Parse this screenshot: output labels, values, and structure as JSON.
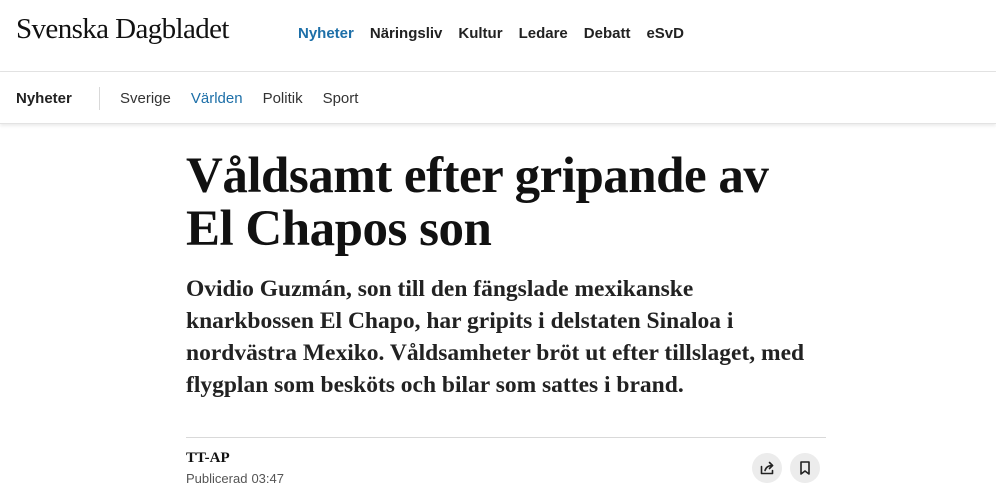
{
  "site": {
    "logo": "Svenska Dagbladet"
  },
  "main_nav": {
    "items": [
      {
        "label": "Nyheter",
        "active": true
      },
      {
        "label": "Näringsliv"
      },
      {
        "label": "Kultur"
      },
      {
        "label": "Ledare"
      },
      {
        "label": "Debatt"
      },
      {
        "label": "eSvD"
      }
    ]
  },
  "sub_nav": {
    "section": "Nyheter",
    "items": [
      {
        "label": "Sverige"
      },
      {
        "label": "Världen",
        "active": true
      },
      {
        "label": "Politik"
      },
      {
        "label": "Sport"
      }
    ]
  },
  "article": {
    "headline": "Våldsamt efter gripande av El Chapos son",
    "lead": "Ovidio Guzmán, son till den fängslade mexikanske knarkbossen El Chapo, har gripits i delstaten Sinaloa i nordvästra Mexiko. Våldsamheter bröt ut efter tillslaget, med flygplan som besköts och bilar som sattes i brand.",
    "author": "TT-AP",
    "published_label": "Publicerad",
    "published_time": "03:47"
  },
  "actions": {
    "share_icon": "share-icon",
    "bookmark_icon": "bookmark-icon"
  },
  "colors": {
    "accent": "#1d6fa8",
    "text": "#111111",
    "button_bg": "#ececec"
  }
}
